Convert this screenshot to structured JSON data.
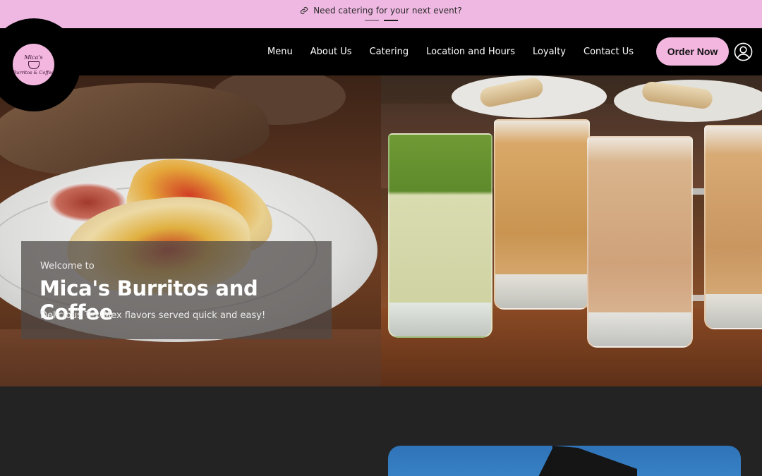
{
  "announcement": {
    "text": "Need catering for your next event?",
    "slides": 2,
    "active_slide": 2
  },
  "logo": {
    "line1": "Mica's",
    "line2": "Burritos & Coffee"
  },
  "nav": {
    "items": [
      "Menu",
      "About Us",
      "Catering",
      "Location and Hours",
      "Loyalty",
      "Contact Us"
    ],
    "order_label": "Order Now",
    "user_icon": "user-circle-icon"
  },
  "hero": {
    "eyebrow": "Welcome to",
    "title": "Mica's Burritos and Coffee",
    "subtitle": "Delicious Tex-Mex flavors served quick and easy!"
  },
  "colors": {
    "brand_pink": "#f2b6df",
    "announcement_bg": "#efb8e2",
    "header_bg": "#000000",
    "section_bg": "#232323"
  }
}
